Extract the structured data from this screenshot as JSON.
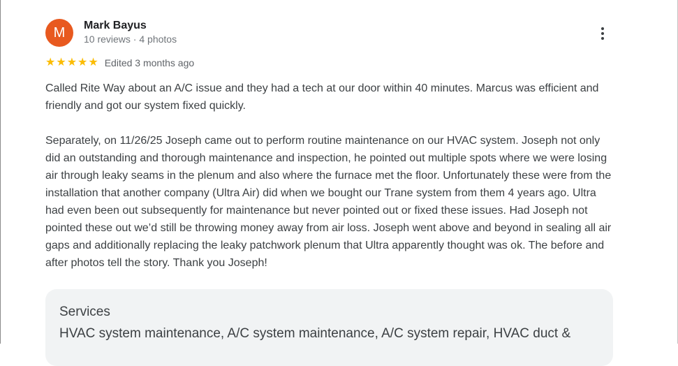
{
  "review": {
    "avatar_letter": "M",
    "avatar_color": "#e8591f",
    "author_name": "Mark Bayus",
    "author_meta": "10 reviews · 4 photos",
    "rating": 5,
    "max_rating": 5,
    "star_color": "#fbbc04",
    "edited": "Edited 3 months ago",
    "more_options_icon": "more-vert-icon",
    "text": "Called Rite Way about an A/C issue and they had a tech at our door within 40 minutes. Marcus was efficient and friendly and got our system fixed quickly.\n\nSeparately, on 11/26/25 Joseph came out to perform routine maintenance on our HVAC system. Joseph not only did an outstanding and thorough maintenance and inspection, he pointed out multiple spots where we were losing air through leaky seams in the plenum and also where the furnace met the floor. Unfortunately these were from the installation that another company (Ultra Air) did when we bought our Trane system from them 4 years ago. Ultra had even been out subsequently for maintenance but never pointed out or fixed these issues. Had Joseph not pointed these out we’d still be throwing money away from air loss. Joseph went above and beyond in sealing all air gaps and additionally replacing the leaky patchwork plenum that Ultra apparently thought was ok. The before and after photos tell the story. Thank you Joseph!",
    "services": {
      "title": "Services",
      "list": "HVAC system maintenance, A/C system maintenance, A/C system repair, HVAC duct &"
    }
  }
}
